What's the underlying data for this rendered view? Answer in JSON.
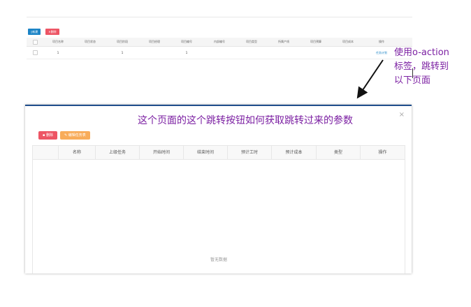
{
  "top_page": {
    "buttons": {
      "add": "新建",
      "delete": "删除"
    },
    "columns": [
      "项目名称",
      "项目状态",
      "项目阶段",
      "项目经理",
      "项目编号",
      "内部编号",
      "项目类型",
      "所属产线",
      "项目预算",
      "项目成本",
      "操作"
    ],
    "row": {
      "c1": "1",
      "c3": "1",
      "c5": "1",
      "action": "任务计划"
    }
  },
  "annotations": {
    "side_note_line1": "使用o-action",
    "side_note_line2": "标签，跳转到",
    "side_note_line3": "以下页面",
    "question": "这个页面的这个跳转按钮如何获取跳转过来的参数"
  },
  "modal": {
    "close_glyph": "×",
    "buttons": {
      "delete": "删除",
      "edit_list": "编辑任务表"
    },
    "columns": [
      "名称",
      "上级任务",
      "开始时间",
      "结束时间",
      "预计工时",
      "预计成本",
      "类型",
      "操作"
    ],
    "empty_text": "暂无数据"
  },
  "colors": {
    "primary": "#1c84c6",
    "danger": "#ed5565",
    "warning": "#f8ac59",
    "annotation": "#7b1fa2",
    "modal_top": "#1f4e8c"
  }
}
